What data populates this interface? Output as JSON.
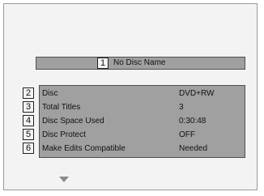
{
  "title": {
    "number": "1",
    "text": "No Disc Name"
  },
  "rows": [
    {
      "number": "2",
      "label": "Disc",
      "value": "DVD+RW"
    },
    {
      "number": "3",
      "label": "Total Titles",
      "value": "3"
    },
    {
      "number": "4",
      "label": "Disc Space Used",
      "value": "0:30:48"
    },
    {
      "number": "5",
      "label": "Disc Protect",
      "value": "OFF"
    },
    {
      "number": "6",
      "label": "Make Edits Compatible",
      "value": "Needed"
    }
  ],
  "icons": {
    "scroll_indicator": "down-arrow-icon"
  }
}
